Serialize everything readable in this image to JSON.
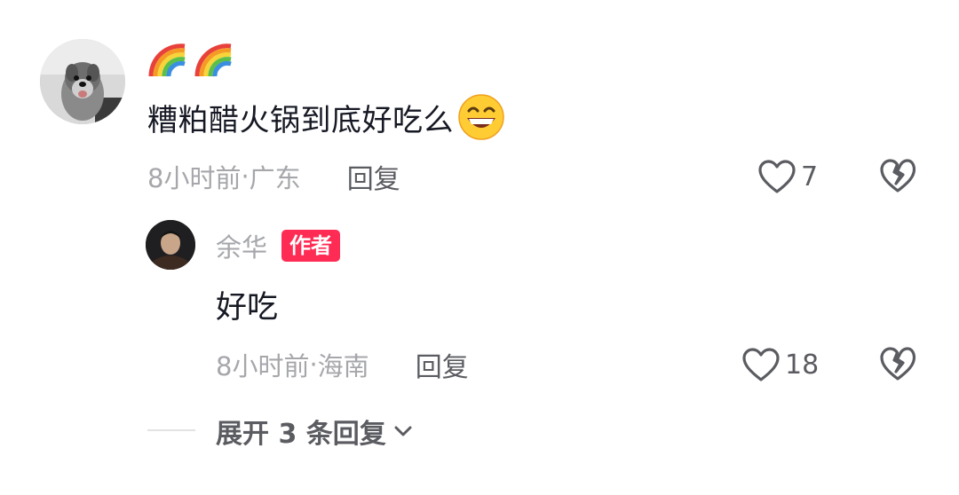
{
  "main_comment": {
    "avatar": "schnauzer-dog-avatar",
    "top_line": "🌈🌈",
    "text": "糟粕醋火锅到底好吃么",
    "emoji": "grinning-face-icon",
    "time": "8小时前",
    "separator": " · ",
    "location": "广东",
    "reply_label": "回复",
    "likes": "7"
  },
  "reply": {
    "avatar": "author-portrait-avatar",
    "author_name": "余华",
    "badge_label": "作者",
    "text": "好吃",
    "time": "8小时前",
    "separator": " · ",
    "location": "海南",
    "reply_label": "回复",
    "likes": "18"
  },
  "expand": {
    "label": "展开 3 条回复"
  },
  "colors": {
    "badge": "#fe2c55",
    "text_primary": "#161823",
    "text_secondary": "#a6a7ab",
    "text_action": "#5b5c61"
  }
}
